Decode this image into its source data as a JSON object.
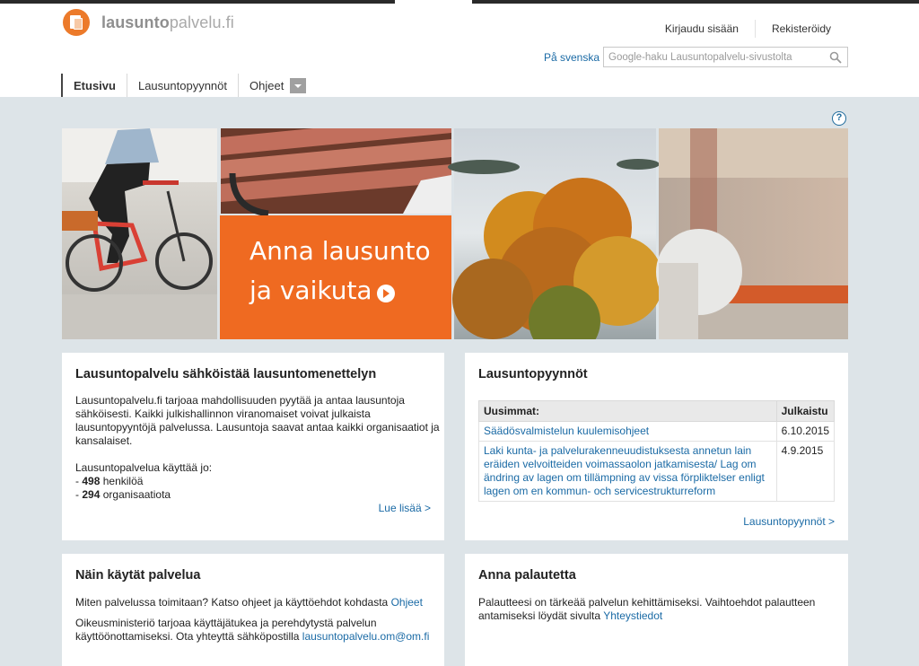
{
  "logo": {
    "brand_bold": "lausunto",
    "brand_light": "palvelu.fi"
  },
  "top_links": {
    "login": "Kirjaudu sisään",
    "register": "Rekisteröidy"
  },
  "language_link": "På svenska",
  "search": {
    "placeholder": "Google-haku Lausuntopalvelu-sivustolta"
  },
  "nav": {
    "items": [
      {
        "label": "Etusivu"
      },
      {
        "label": "Lausuntopyynnöt"
      },
      {
        "label": "Ohjeet"
      }
    ]
  },
  "help_icon": "?",
  "hero": {
    "line1": "Anna lausunto",
    "line2": "ja vaikuta"
  },
  "about": {
    "title": "Lausuntopalvelu sähköistää lausuntomenettelyn",
    "p1_lines": [
      "Lausuntopalvelu.fi tarjoaa mahdollisuuden pyytää ja antaa lausuntoja",
      "sähköisesti. Kaikki julkishallinnon viranomaiset voivat julkaista",
      "lausuntopyyntöjä palvelussa. Lausuntoja saavat antaa kaikki organisaatiot ja",
      "kansalaiset."
    ],
    "users_intro": "Lausuntopalvelua käyttää jo:",
    "persons_count": "498",
    "persons_label": "henkilöä",
    "orgs_count": "294",
    "orgs_label": "organisaatiota",
    "read_more": "Lue lisää >"
  },
  "requests": {
    "title": "Lausuntopyynnöt",
    "columns": [
      "Uusimmat:",
      "Julkaistu"
    ],
    "rows": [
      {
        "title_lines": [
          "Säädösvalmistelun kuulemisohjeet"
        ],
        "date": "6.10.2015"
      },
      {
        "title_lines": [
          "Laki kunta- ja palvelurakenneuudistuksesta annetun lain",
          "eräiden velvoitteiden voimassaolon jatkamisesta/ Lag om",
          "ändring av lagen om tillämpning av vissa förpliktelser enligt",
          "lagen om en kommun- och servicestrukturreform"
        ],
        "date": "4.9.2015"
      }
    ],
    "more": "Lausuntopyynnöt >"
  },
  "howto": {
    "title": "Näin käytät palvelua",
    "p1_text": "Miten palvelussa toimitaan? Katso ohjeet ja käyttöehdot kohdasta ",
    "p1_link": "Ohjeet",
    "p2_line1": "Oikeusministeriö tarjoaa käyttäjätukea ja perehdytystä palvelun",
    "p2_line2_text": "käyttöönottamiseksi. Ota yhteyttä sähköpostilla ",
    "p2_email": "lausuntopalvelu.om@om.fi"
  },
  "feedback": {
    "title": "Anna palautetta",
    "line1": "Palautteesi on tärkeää palvelun kehittämiseksi. Vaihtoehdot palautteen",
    "line2_text": "antamiseksi löydät sivulta ",
    "line2_link": "Yhteystiedot"
  },
  "colors": {
    "accent_orange": "#ef6a21",
    "link_blue": "#1a6aa5",
    "page_bg": "#dde4e8"
  }
}
